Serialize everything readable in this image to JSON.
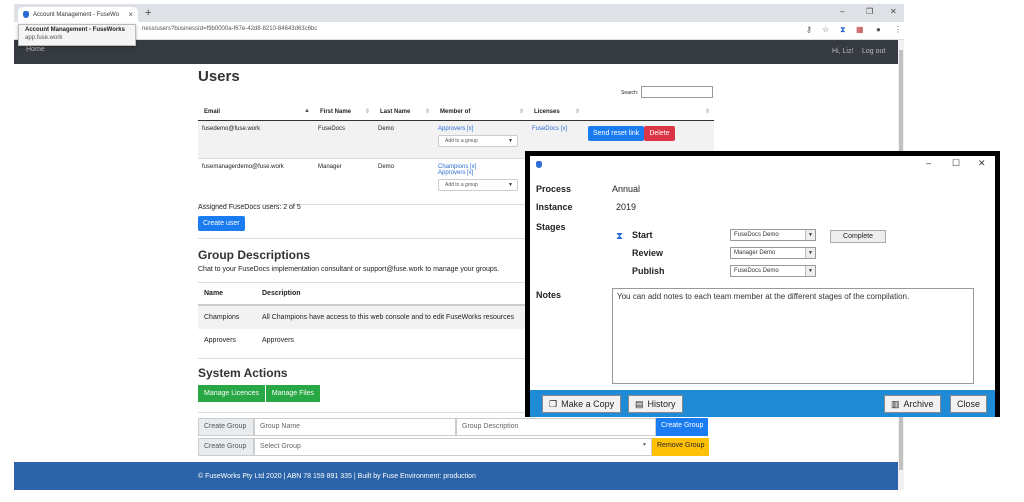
{
  "browser": {
    "tab_title": "Account Management - FuseWo",
    "tab_close": "×",
    "new_tab": "+",
    "url": "ness/users?businessId=f9b0000a-f67e-42d8-8210-84643d63c6bc",
    "tooltip_title": "Account Management - FuseWorks",
    "tooltip_sub": "app.fuse.work",
    "win_min": "–",
    "win_max": "❐",
    "win_close": "✕"
  },
  "navbar": {
    "home": "Home",
    "greeting": "Hi, Liz!",
    "logout": "Log out"
  },
  "users": {
    "title": "Users",
    "search_label": "Search:",
    "columns": [
      "Email",
      "First Name",
      "Last Name",
      "Member of",
      "Licenses"
    ],
    "rows": [
      {
        "email": "fusedemo@fuse.work",
        "first": "FuseDocs",
        "last": "Demo",
        "groups": [
          "Approvers [x]"
        ],
        "add_group": "Add to a group",
        "license": "FuseDocs [x]"
      },
      {
        "email": "fusemanagerdemo@fuse.work",
        "first": "Manager",
        "last": "Demo",
        "groups": [
          "Champions [x]",
          "Approvers [x]"
        ],
        "add_group": "Add to a group",
        "license": ""
      }
    ],
    "send_reset": "Send reset link",
    "delete": "Delete",
    "assigned": "Assigned FuseDocs users: 2 of 5",
    "create_user": "Create user"
  },
  "groups": {
    "title": "Group Descriptions",
    "subtitle": "Chat to your FuseDocs implementation consultant or support@fuse.work to manage your groups.",
    "col_name": "Name",
    "col_desc": "Description",
    "rows": [
      {
        "name": "Champions",
        "desc": "All Champions have access to this web console and to edit FuseWorks resources"
      },
      {
        "name": "Approvers",
        "desc": "Approvers"
      }
    ]
  },
  "system": {
    "title": "System Actions",
    "manage_licences": "Manage Licences",
    "manage_files": "Manage Files",
    "create_group_label": "Create Group",
    "group_name_ph": "Group Name",
    "group_desc_ph": "Group Description",
    "create_group_btn": "Create Group",
    "select_group": "Select Group",
    "remove_group": "Remove Group"
  },
  "footer": {
    "text": "© FuseWorks Pty Ltd 2020 | ABN 78 159 891 335 | Built by Fuse Environment: production"
  },
  "dialog": {
    "process_label": "Process",
    "process_value": "Annual",
    "instance_label": "Instance",
    "instance_value": "2019",
    "stages_label": "Stages",
    "stages": [
      {
        "name": "Start",
        "assignee": "FuseDocs Demo"
      },
      {
        "name": "Review",
        "assignee": "Manager Demo"
      },
      {
        "name": "Publish",
        "assignee": "FuseDocs Demo"
      }
    ],
    "complete": "Complete",
    "notes_label": "Notes",
    "notes_text": "You can add notes to each team member at the different stages of the compilation.",
    "make_copy": "Make a Copy",
    "history": "History",
    "archive": "Archive",
    "close": "Close",
    "ctrl_min": "–",
    "ctrl_max": "☐",
    "ctrl_close": "✕"
  },
  "colors": {
    "primary": "#1a7cf0",
    "danger": "#dc3545",
    "success": "#28a745",
    "warning": "#ffc107",
    "navbar": "#353b41",
    "footer": "#2a63a8",
    "dialog_footer": "#1f8ad6"
  }
}
